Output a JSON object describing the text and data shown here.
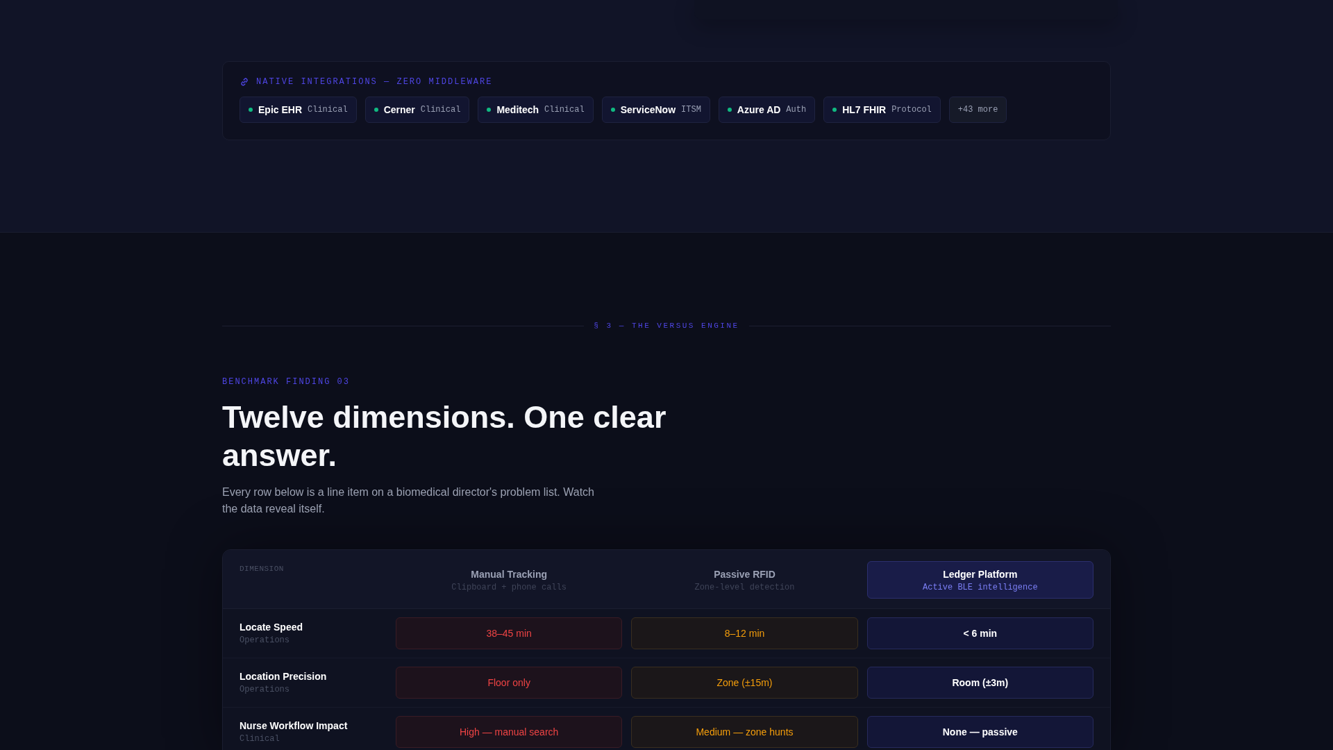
{
  "integrations": {
    "title": "NATIVE INTEGRATIONS — ZERO MIDDLEWARE",
    "items": [
      {
        "name": "Epic EHR",
        "category": "Clinical",
        "color": "#10b981"
      },
      {
        "name": "Cerner",
        "category": "Clinical",
        "color": "#10b981"
      },
      {
        "name": "Meditech",
        "category": "Clinical",
        "color": "#10b981"
      },
      {
        "name": "ServiceNow",
        "category": "ITSM",
        "color": "#10b981"
      },
      {
        "name": "Azure AD",
        "category": "Auth",
        "color": "#10b981"
      },
      {
        "name": "HL7 FHIR",
        "category": "Protocol",
        "color": "#10b981"
      }
    ],
    "more": "+43 more"
  },
  "section_label": "§ 3 — THE VERSUS ENGINE",
  "eyebrow": "BENCHMARK FINDING 03",
  "heading": "Twelve dimensions. One clear answer.",
  "intro": "Every row below is a line item on a biomedical director's problem list. Watch the data reveal itself.",
  "table": {
    "dimension_header": "DIMENSION",
    "columns": [
      {
        "title": "Manual Tracking",
        "subtitle": "Clipboard + phone calls",
        "kind": "bad",
        "selected": false
      },
      {
        "title": "Passive RFID",
        "subtitle": "Zone-level detection",
        "kind": "mid",
        "selected": false
      },
      {
        "title": "Ledger Platform",
        "subtitle": "Active BLE intelligence",
        "kind": "good",
        "selected": true
      }
    ],
    "rows": [
      {
        "name": "Locate Speed",
        "group": "Operations",
        "values": [
          "38–45 min",
          "8–12 min",
          "< 6 min"
        ]
      },
      {
        "name": "Location Precision",
        "group": "Operations",
        "values": [
          "Floor only",
          "Zone (±15m)",
          "Room (±3m)"
        ]
      },
      {
        "name": "Nurse Workflow Impact",
        "group": "Clinical",
        "values": [
          "High — manual search",
          "Medium — zone hunts",
          "None — passive"
        ]
      }
    ]
  }
}
